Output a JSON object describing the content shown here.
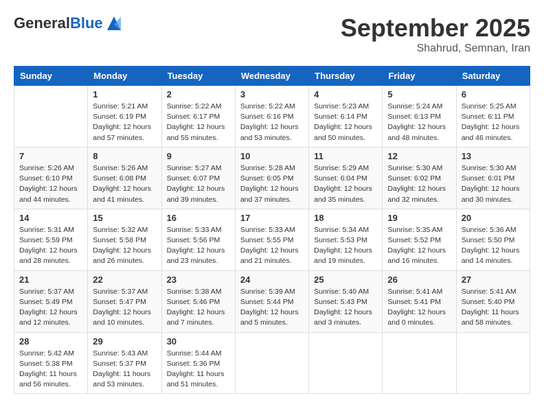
{
  "logo": {
    "general": "General",
    "blue": "Blue"
  },
  "header": {
    "month": "September 2025",
    "location": "Shahrud, Semnan, Iran"
  },
  "weekdays": [
    "Sunday",
    "Monday",
    "Tuesday",
    "Wednesday",
    "Thursday",
    "Friday",
    "Saturday"
  ],
  "weeks": [
    [
      {
        "day": "",
        "info": ""
      },
      {
        "day": "1",
        "info": "Sunrise: 5:21 AM\nSunset: 6:19 PM\nDaylight: 12 hours\nand 57 minutes."
      },
      {
        "day": "2",
        "info": "Sunrise: 5:22 AM\nSunset: 6:17 PM\nDaylight: 12 hours\nand 55 minutes."
      },
      {
        "day": "3",
        "info": "Sunrise: 5:22 AM\nSunset: 6:16 PM\nDaylight: 12 hours\nand 53 minutes."
      },
      {
        "day": "4",
        "info": "Sunrise: 5:23 AM\nSunset: 6:14 PM\nDaylight: 12 hours\nand 50 minutes."
      },
      {
        "day": "5",
        "info": "Sunrise: 5:24 AM\nSunset: 6:13 PM\nDaylight: 12 hours\nand 48 minutes."
      },
      {
        "day": "6",
        "info": "Sunrise: 5:25 AM\nSunset: 6:11 PM\nDaylight: 12 hours\nand 46 minutes."
      }
    ],
    [
      {
        "day": "7",
        "info": "Sunrise: 5:26 AM\nSunset: 6:10 PM\nDaylight: 12 hours\nand 44 minutes."
      },
      {
        "day": "8",
        "info": "Sunrise: 5:26 AM\nSunset: 6:08 PM\nDaylight: 12 hours\nand 41 minutes."
      },
      {
        "day": "9",
        "info": "Sunrise: 5:27 AM\nSunset: 6:07 PM\nDaylight: 12 hours\nand 39 minutes."
      },
      {
        "day": "10",
        "info": "Sunrise: 5:28 AM\nSunset: 6:05 PM\nDaylight: 12 hours\nand 37 minutes."
      },
      {
        "day": "11",
        "info": "Sunrise: 5:29 AM\nSunset: 6:04 PM\nDaylight: 12 hours\nand 35 minutes."
      },
      {
        "day": "12",
        "info": "Sunrise: 5:30 AM\nSunset: 6:02 PM\nDaylight: 12 hours\nand 32 minutes."
      },
      {
        "day": "13",
        "info": "Sunrise: 5:30 AM\nSunset: 6:01 PM\nDaylight: 12 hours\nand 30 minutes."
      }
    ],
    [
      {
        "day": "14",
        "info": "Sunrise: 5:31 AM\nSunset: 5:59 PM\nDaylight: 12 hours\nand 28 minutes."
      },
      {
        "day": "15",
        "info": "Sunrise: 5:32 AM\nSunset: 5:58 PM\nDaylight: 12 hours\nand 26 minutes."
      },
      {
        "day": "16",
        "info": "Sunrise: 5:33 AM\nSunset: 5:56 PM\nDaylight: 12 hours\nand 23 minutes."
      },
      {
        "day": "17",
        "info": "Sunrise: 5:33 AM\nSunset: 5:55 PM\nDaylight: 12 hours\nand 21 minutes."
      },
      {
        "day": "18",
        "info": "Sunrise: 5:34 AM\nSunset: 5:53 PM\nDaylight: 12 hours\nand 19 minutes."
      },
      {
        "day": "19",
        "info": "Sunrise: 5:35 AM\nSunset: 5:52 PM\nDaylight: 12 hours\nand 16 minutes."
      },
      {
        "day": "20",
        "info": "Sunrise: 5:36 AM\nSunset: 5:50 PM\nDaylight: 12 hours\nand 14 minutes."
      }
    ],
    [
      {
        "day": "21",
        "info": "Sunrise: 5:37 AM\nSunset: 5:49 PM\nDaylight: 12 hours\nand 12 minutes."
      },
      {
        "day": "22",
        "info": "Sunrise: 5:37 AM\nSunset: 5:47 PM\nDaylight: 12 hours\nand 10 minutes."
      },
      {
        "day": "23",
        "info": "Sunrise: 5:38 AM\nSunset: 5:46 PM\nDaylight: 12 hours\nand 7 minutes."
      },
      {
        "day": "24",
        "info": "Sunrise: 5:39 AM\nSunset: 5:44 PM\nDaylight: 12 hours\nand 5 minutes."
      },
      {
        "day": "25",
        "info": "Sunrise: 5:40 AM\nSunset: 5:43 PM\nDaylight: 12 hours\nand 3 minutes."
      },
      {
        "day": "26",
        "info": "Sunrise: 5:41 AM\nSunset: 5:41 PM\nDaylight: 12 hours\nand 0 minutes."
      },
      {
        "day": "27",
        "info": "Sunrise: 5:41 AM\nSunset: 5:40 PM\nDaylight: 11 hours\nand 58 minutes."
      }
    ],
    [
      {
        "day": "28",
        "info": "Sunrise: 5:42 AM\nSunset: 5:38 PM\nDaylight: 11 hours\nand 56 minutes."
      },
      {
        "day": "29",
        "info": "Sunrise: 5:43 AM\nSunset: 5:37 PM\nDaylight: 11 hours\nand 53 minutes."
      },
      {
        "day": "30",
        "info": "Sunrise: 5:44 AM\nSunset: 5:36 PM\nDaylight: 11 hours\nand 51 minutes."
      },
      {
        "day": "",
        "info": ""
      },
      {
        "day": "",
        "info": ""
      },
      {
        "day": "",
        "info": ""
      },
      {
        "day": "",
        "info": ""
      }
    ]
  ]
}
